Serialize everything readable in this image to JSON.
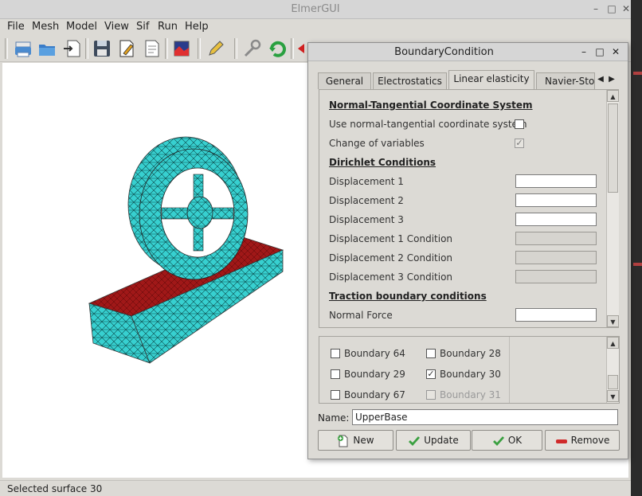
{
  "app": {
    "title": "ElmerGUI"
  },
  "menubar": {
    "items": [
      "File",
      "Mesh",
      "Model",
      "View",
      "Sif",
      "Run",
      "Help"
    ]
  },
  "statusbar": {
    "text": "Selected surface 30"
  },
  "dialog": {
    "title": "BoundaryCondition",
    "tabs": [
      "General",
      "Electrostatics",
      "Linear elasticity",
      "Navier-Stok"
    ],
    "active_tab": "Linear elasticity",
    "sections": {
      "normal_tangential": "Normal-Tangential Coordinate System",
      "dirichlet": "Dirichlet Conditions",
      "traction": "Traction boundary conditions"
    },
    "fields": {
      "use_nt": {
        "label": "Use normal-tangential coordinate system",
        "checked": false
      },
      "change_vars": {
        "label": "Change of variables",
        "checked": true,
        "enabled": false
      },
      "disp1": {
        "label": "Displacement 1",
        "value": ""
      },
      "disp2": {
        "label": "Displacement 2",
        "value": ""
      },
      "disp3": {
        "label": "Displacement 3",
        "value": ""
      },
      "disp1_cond": {
        "label": "Displacement 1 Condition",
        "value": ""
      },
      "disp2_cond": {
        "label": "Displacement 2 Condition",
        "value": ""
      },
      "disp3_cond": {
        "label": "Displacement 3 Condition",
        "value": ""
      },
      "normal_force": {
        "label": "Normal Force",
        "value": ""
      }
    },
    "boundaries": [
      {
        "label": "Boundary 64",
        "checked": false,
        "enabled": true
      },
      {
        "label": "Boundary 28",
        "checked": false,
        "enabled": true
      },
      {
        "label": "Boundary 29",
        "checked": false,
        "enabled": true
      },
      {
        "label": "Boundary 30",
        "checked": true,
        "enabled": true
      },
      {
        "label": "Boundary 67",
        "checked": false,
        "enabled": true
      },
      {
        "label": "Boundary 31",
        "checked": false,
        "enabled": false
      }
    ],
    "name": {
      "label": "Name:",
      "value": "UpperBase"
    },
    "buttons": {
      "new": "New",
      "update": "Update",
      "ok": "OK",
      "remove": "Remove"
    }
  },
  "colors": {
    "mesh_cyan": "#37d0d0",
    "mesh_red": "#a01818",
    "window_bg": "#dcdad5"
  },
  "icons": {
    "toolbar": [
      "print-icon",
      "open-icon",
      "import-icon",
      "save-icon",
      "edit-icon",
      "document-icon",
      "image-icon",
      "pencil-icon",
      "wrench-icon",
      "refresh-icon",
      "arrow-icon"
    ]
  }
}
